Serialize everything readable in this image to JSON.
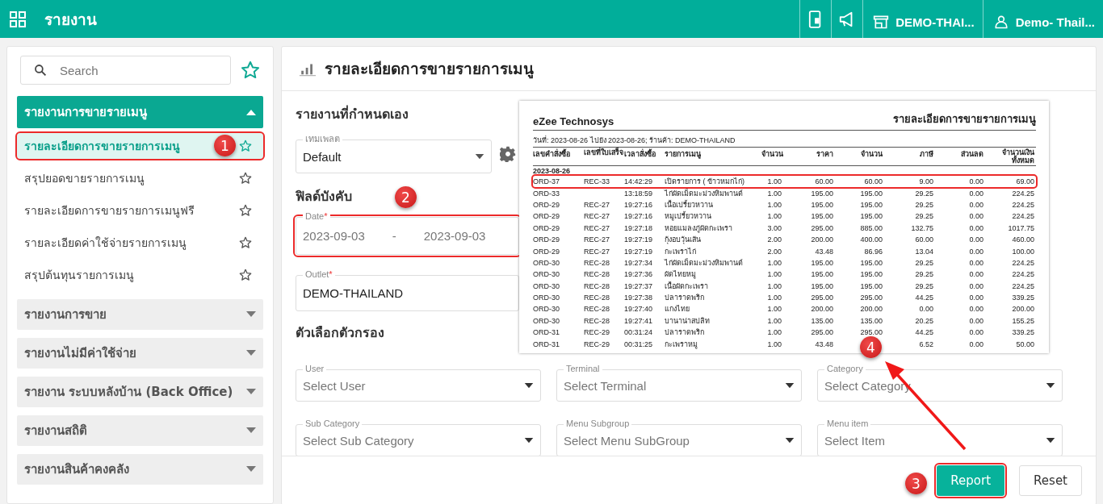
{
  "topbar": {
    "title": "รายงาน",
    "outlet": "DEMO-THAI...",
    "user": "Demo- Thail..."
  },
  "sidebar": {
    "search": {
      "placeholder": "Search"
    },
    "groups": [
      {
        "title": "รายงานการขายรายเมนู",
        "expanded": true,
        "items": [
          {
            "label": "รายละเอียดการขายรายการเมนู",
            "selected": true,
            "highlighted": true,
            "step": "1"
          },
          {
            "label": "สรุปยอดขายรายการเมนู",
            "selected": false,
            "highlighted": false
          },
          {
            "label": "รายละเอียดการขายรายการเมนูฟรี",
            "selected": false,
            "highlighted": false
          },
          {
            "label": "รายละเอียดค่าใช้จ่ายรายการเมนู",
            "selected": false,
            "highlighted": false
          },
          {
            "label": "สรุปต้นทุนรายการเมนู",
            "selected": false,
            "highlighted": false
          }
        ]
      },
      {
        "title": "รายงานการขาย",
        "expanded": false
      },
      {
        "title": "รายงานไม่มีค่าใช้จ่าย",
        "expanded": false
      },
      {
        "title": "รายงาน ระบบหลังบ้าน (Back Office)",
        "expanded": false
      },
      {
        "title": "รายงานสถิติ",
        "expanded": false
      },
      {
        "title": "รายงานสินค้าคงคลัง",
        "expanded": false
      }
    ]
  },
  "main": {
    "title": "รายละเอียดการขายรายการเมนู",
    "custom_section": "รายงานที่กำหนดเอง",
    "template": {
      "label": "เทมเพลต",
      "value": "Default"
    },
    "required_section": "ฟิลด์บังคับ",
    "required_step": "2",
    "date": {
      "label": "Date",
      "required_mark": "*",
      "highlighted": true,
      "from": "2023-09-03",
      "separator": "-",
      "to": "2023-09-03"
    },
    "outlet": {
      "label": "Outlet",
      "required_mark": "*",
      "value": "DEMO-THAILAND"
    },
    "filter_section": "ตัวเลือกตัวกรอง",
    "filters": [
      {
        "label": "User",
        "placeholder": "Select User"
      },
      {
        "label": "Terminal",
        "placeholder": "Select Terminal"
      },
      {
        "label": "Category",
        "placeholder": "Select Category"
      },
      {
        "label": "Sub Category",
        "placeholder": "Select Sub Category"
      },
      {
        "label": "Menu Subgroup",
        "placeholder": "Select Menu SubGroup"
      },
      {
        "label": "Menu item",
        "placeholder": "Select Item"
      }
    ],
    "buttons": [
      {
        "label": "Report",
        "kind": "primary",
        "highlighted": true,
        "step": "3"
      },
      {
        "label": "Reset",
        "kind": "secondary",
        "highlighted": false
      }
    ]
  },
  "preview": {
    "company": "eZee Technosys",
    "title": "รายละเอียดการขายรายการเมนู",
    "subtitle": "วันที่: 2023-08-26 ไปยัง 2023-08-26; ร้านค้า: DEMO-THAILAND",
    "step": "4",
    "columns": [
      "เลขคำสั่งซื้อ",
      "เลขที่ใบเสร็จ",
      "เวลาสั่งซื้อ",
      "รายการเมนู",
      "จำนวน",
      "ราคา",
      "จำนวน",
      "ภาษี",
      "ส่วนลด",
      "จำนวนเงินทั้งหมด"
    ],
    "group": "2023-08-26",
    "rows": [
      {
        "highlighted": true,
        "cells": [
          "ORD-37",
          "REC-33",
          "14:42:29",
          "เปิดรายการ ( ข้าวหมกไก่)",
          "1.00",
          "60.00",
          "60.00",
          "9.00",
          "0.00",
          "69.00"
        ]
      },
      {
        "highlighted": false,
        "cells": [
          "ORD-33",
          "",
          "13:18:59",
          "ไก่ผัดเม็ดมะม่วงหิมพานต์",
          "1.00",
          "195.00",
          "195.00",
          "29.25",
          "0.00",
          "224.25"
        ]
      },
      {
        "highlighted": false,
        "cells": [
          "ORD-29",
          "REC-27",
          "19:27:16",
          "เนื้อเปรี้ยวหวาน",
          "1.00",
          "195.00",
          "195.00",
          "29.25",
          "0.00",
          "224.25"
        ]
      },
      {
        "highlighted": false,
        "cells": [
          "ORD-29",
          "REC-27",
          "19:27:16",
          "หมูเปรี้ยวหวาน",
          "1.00",
          "195.00",
          "195.00",
          "29.25",
          "0.00",
          "224.25"
        ]
      },
      {
        "highlighted": false,
        "cells": [
          "ORD-29",
          "REC-27",
          "19:27:18",
          "หอยแมลงภู่ผัดกะเพรา",
          "3.00",
          "295.00",
          "885.00",
          "132.75",
          "0.00",
          "1017.75"
        ]
      },
      {
        "highlighted": false,
        "cells": [
          "ORD-29",
          "REC-27",
          "19:27:19",
          "กุ้งอบวุ้นเส้น",
          "2.00",
          "200.00",
          "400.00",
          "60.00",
          "0.00",
          "460.00"
        ]
      },
      {
        "highlighted": false,
        "cells": [
          "ORD-29",
          "REC-27",
          "19:27:19",
          "กะเพราไก่",
          "2.00",
          "43.48",
          "86.96",
          "13.04",
          "0.00",
          "100.00"
        ]
      },
      {
        "highlighted": false,
        "cells": [
          "ORD-30",
          "REC-28",
          "19:27:34",
          "ไก่ผัดเม็ดมะม่วงหิมพานต์",
          "1.00",
          "195.00",
          "195.00",
          "29.25",
          "0.00",
          "224.25"
        ]
      },
      {
        "highlighted": false,
        "cells": [
          "ORD-30",
          "REC-28",
          "19:27:36",
          "ผัดไทยหมู",
          "1.00",
          "195.00",
          "195.00",
          "29.25",
          "0.00",
          "224.25"
        ]
      },
      {
        "highlighted": false,
        "cells": [
          "ORD-30",
          "REC-28",
          "19:27:37",
          "เนื้อผัดกะเพรา",
          "1.00",
          "195.00",
          "195.00",
          "29.25",
          "0.00",
          "224.25"
        ]
      },
      {
        "highlighted": false,
        "cells": [
          "ORD-30",
          "REC-28",
          "19:27:38",
          "ปลาราดพริก",
          "1.00",
          "295.00",
          "295.00",
          "44.25",
          "0.00",
          "339.25"
        ]
      },
      {
        "highlighted": false,
        "cells": [
          "ORD-30",
          "REC-28",
          "19:27:40",
          "แกงไทย",
          "1.00",
          "200.00",
          "200.00",
          "0.00",
          "0.00",
          "200.00"
        ]
      },
      {
        "highlighted": false,
        "cells": [
          "ORD-30",
          "REC-28",
          "19:27:41",
          "บานาน่าสปลิท",
          "1.00",
          "135.00",
          "135.00",
          "20.25",
          "0.00",
          "155.25"
        ]
      },
      {
        "highlighted": false,
        "cells": [
          "ORD-31",
          "REC-29",
          "00:31:24",
          "ปลาราดพริก",
          "1.00",
          "295.00",
          "295.00",
          "44.25",
          "0.00",
          "339.25"
        ]
      },
      {
        "highlighted": false,
        "cells": [
          "ORD-31",
          "REC-29",
          "00:31:25",
          "กะเพราหมู",
          "1.00",
          "43.48",
          "",
          "6.52",
          "0.00",
          "50.00"
        ]
      }
    ]
  }
}
